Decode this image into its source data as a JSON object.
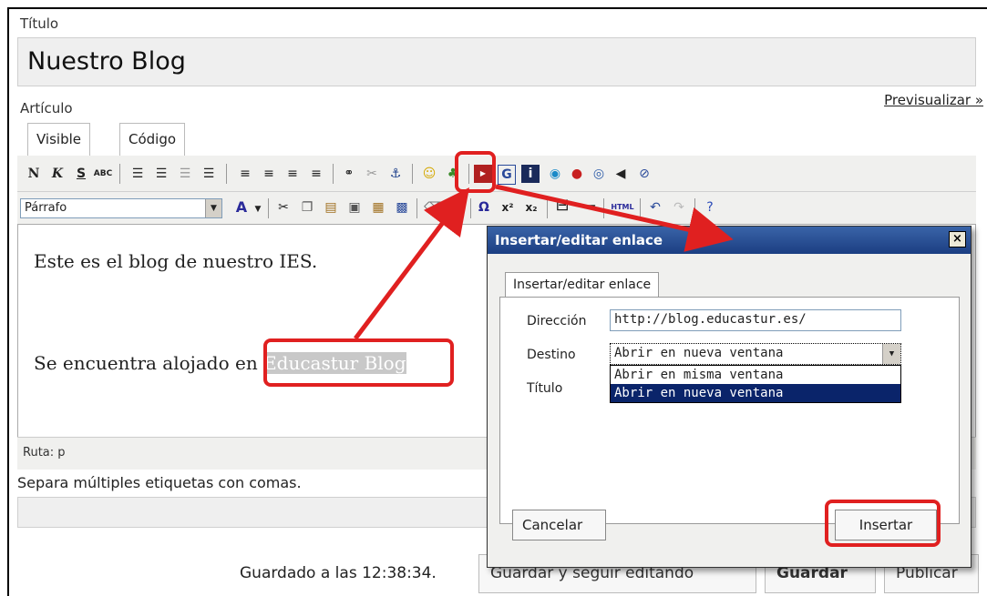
{
  "title_field": {
    "label": "Título",
    "value": "Nuestro Blog"
  },
  "article": {
    "label": "Artículo",
    "preview_link": "Previsualizar »"
  },
  "editor_tabs": [
    "Visible",
    "Código"
  ],
  "toolbar": {
    "bold": "N",
    "italic": "K",
    "strike": "S",
    "spell": "ABC",
    "format_select": "Párrafo",
    "font_color": "A",
    "omega": "Ω",
    "superscript": "x²",
    "subscript": "x₂",
    "html_button": "HTML"
  },
  "content": {
    "paragraph1": "Este es el blog de nuestro IES.",
    "paragraph2_prefix": "Se encuentra alojado en ",
    "paragraph2_link": "Educastur Blog"
  },
  "statusbar": {
    "path": "Ruta: p"
  },
  "tags": {
    "hint": "Separa múltiples etiquetas con comas."
  },
  "footer": {
    "saved_text": "Guardado a las 12:38:34.",
    "save_continue": "Guardar y seguir editando",
    "save": "Guardar",
    "publish": "Publicar"
  },
  "dialog": {
    "title": "Insertar/editar enlace",
    "close": "×",
    "tab": "Insertar/editar enlace",
    "direction_label": "Dirección",
    "direction_value": "http://blog.educastur.es/",
    "target_label": "Destino",
    "target_selected": "Abrir en nueva ventana",
    "target_options": [
      "Abrir en misma ventana",
      "Abrir en nueva ventana"
    ],
    "title_label": "Título",
    "cancel": "Cancelar",
    "insert": "Insertar"
  },
  "colors": {
    "callout": "#e02020",
    "selection": "#c8c8c8",
    "dialog_title": "#1b3e82",
    "list_highlight": "#0a246a"
  }
}
